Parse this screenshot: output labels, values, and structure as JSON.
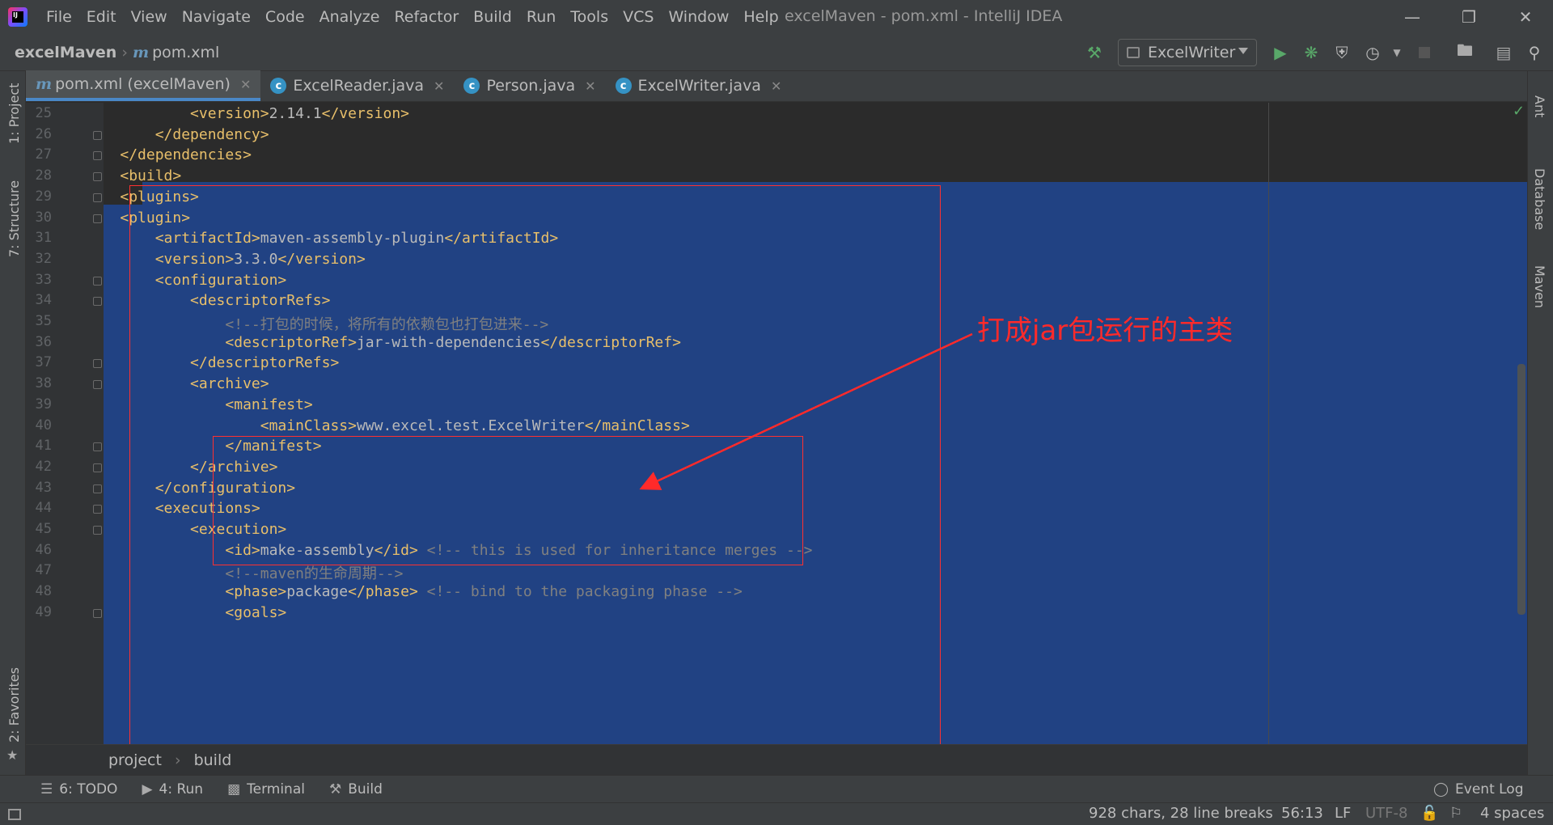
{
  "window": {
    "title": "excelMaven - pom.xml - IntelliJ IDEA",
    "menu": [
      "File",
      "Edit",
      "View",
      "Navigate",
      "Code",
      "Analyze",
      "Refactor",
      "Build",
      "Run",
      "Tools",
      "VCS",
      "Window",
      "Help"
    ]
  },
  "navbar": {
    "project": "excelMaven",
    "file": "pom.xml",
    "run_config": "ExcelWriter"
  },
  "tabs": [
    {
      "label": "pom.xml (excelMaven)",
      "icon": "maven-icon",
      "active": true
    },
    {
      "label": "ExcelReader.java",
      "icon": "class-icon",
      "active": false
    },
    {
      "label": "Person.java",
      "icon": "class-icon",
      "active": false
    },
    {
      "label": "ExcelWriter.java",
      "icon": "class-icon",
      "active": false
    }
  ],
  "left_tools": {
    "project": "1: Project",
    "structure": "7: Structure",
    "favorites": "2: Favorites"
  },
  "right_tools": {
    "ant": "Ant",
    "database": "Database",
    "maven": "Maven"
  },
  "editor": {
    "lines": [
      {
        "n": "25",
        "text": "            <version>2.14.1</version>"
      },
      {
        "n": "26",
        "text": "        </dependency>"
      },
      {
        "n": "27",
        "text": "    </dependencies>"
      },
      {
        "n": "28",
        "text": "    <build>"
      },
      {
        "n": "29",
        "text": "    <plugins>"
      },
      {
        "n": "30",
        "text": "    <plugin>"
      },
      {
        "n": "31",
        "text": "        <artifactId>maven-assembly-plugin</artifactId>"
      },
      {
        "n": "32",
        "text": "        <version>3.3.0</version>"
      },
      {
        "n": "33",
        "text": "        <configuration>"
      },
      {
        "n": "34",
        "text": "            <descriptorRefs>"
      },
      {
        "n": "35",
        "text": "                <!--打包的时候，将所有的依赖包也打包进来-->"
      },
      {
        "n": "36",
        "text": "                <descriptorRef>jar-with-dependencies</descriptorRef>"
      },
      {
        "n": "37",
        "text": "            </descriptorRefs>"
      },
      {
        "n": "38",
        "text": "            <archive>"
      },
      {
        "n": "39",
        "text": "                <manifest>"
      },
      {
        "n": "40",
        "text": "                    <mainClass>www.excel.test.ExcelWriter</mainClass>"
      },
      {
        "n": "41",
        "text": "                </manifest>"
      },
      {
        "n": "42",
        "text": "            </archive>"
      },
      {
        "n": "43",
        "text": "        </configuration>"
      },
      {
        "n": "44",
        "text": "        <executions>"
      },
      {
        "n": "45",
        "text": "            <execution>"
      },
      {
        "n": "46",
        "text": "                <id>make-assembly</id> <!-- this is used for inheritance merges -->"
      },
      {
        "n": "47",
        "text": "                <!--maven的生命周期-->"
      },
      {
        "n": "48",
        "text": "                <phase>package</phase> <!-- bind to the packaging phase -->"
      },
      {
        "n": "49",
        "text": "                <goals>"
      }
    ],
    "annotation": "打成jar包运行的主类"
  },
  "breadcrumbs": [
    "project",
    "build"
  ],
  "bottom_tools": [
    {
      "label": "6: TODO",
      "icon": "list-icon"
    },
    {
      "label": "4: Run",
      "icon": "play-icon"
    },
    {
      "label": "Terminal",
      "icon": "terminal-icon"
    },
    {
      "label": "Build",
      "icon": "hammer-icon"
    }
  ],
  "event_log": "Event Log",
  "status": {
    "selection": "928 chars, 28 line breaks",
    "position": "56:13",
    "line_sep": "LF",
    "encoding": "UTF-8",
    "indent": "4 spaces"
  },
  "colors": {
    "selection": "#214283",
    "tag": "#e8bf6a",
    "comment": "#808080",
    "annotation": "#ff2a2a"
  }
}
